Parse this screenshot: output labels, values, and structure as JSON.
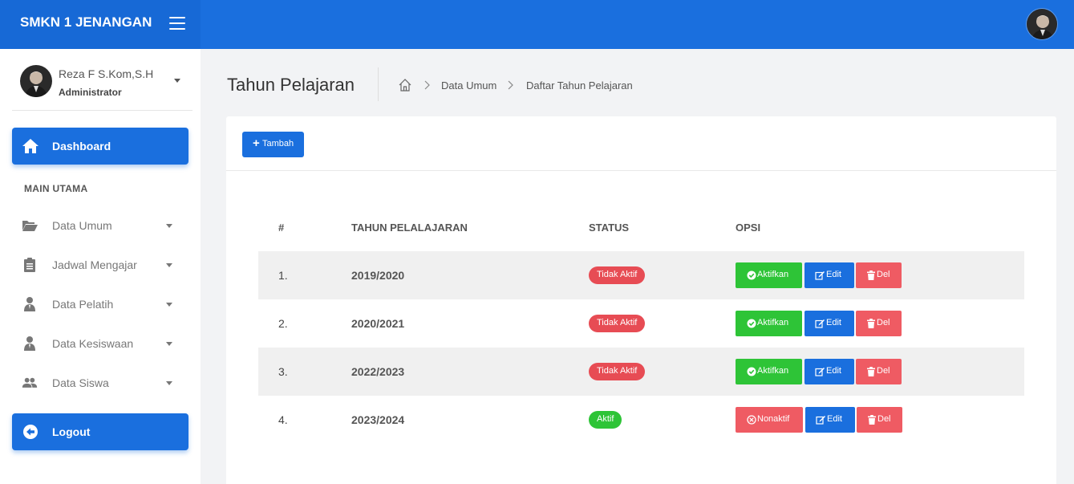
{
  "app": {
    "brand": "SMKN 1 JENANGAN"
  },
  "user": {
    "name": "Reza F S.Kom,S.H",
    "role": "Administrator"
  },
  "sidebar": {
    "dashboard_label": "Dashboard",
    "section_title": "MAIN UTAMA",
    "items": [
      {
        "label": "Data Umum",
        "icon": "folder-open-icon"
      },
      {
        "label": "Jadwal Mengajar",
        "icon": "clipboard-icon"
      },
      {
        "label": "Data Pelatih",
        "icon": "user-icon"
      },
      {
        "label": "Data Kesiswaan",
        "icon": "user-icon"
      },
      {
        "label": "Data Siswa",
        "icon": "users-icon"
      }
    ],
    "logout_label": "Logout"
  },
  "page": {
    "title": "Tahun Pelajaran",
    "breadcrumb": [
      "Data Umum",
      "Daftar Tahun Pelajaran"
    ]
  },
  "toolbar": {
    "add_label": "Tambah"
  },
  "table": {
    "headers": [
      "#",
      "TAHUN PELALAJARAN",
      "STATUS",
      "OPSI"
    ],
    "rows": [
      {
        "no": "1.",
        "year": "2019/2020",
        "status": "Tidak Aktif",
        "toggle": "Aktifkan",
        "edit": "Edit",
        "del": "Del"
      },
      {
        "no": "2.",
        "year": "2020/2021",
        "status": "Tidak Aktif",
        "toggle": "Aktifkan",
        "edit": "Edit",
        "del": "Del"
      },
      {
        "no": "3.",
        "year": "2022/2023",
        "status": "Tidak Aktif",
        "toggle": "Aktifkan",
        "edit": "Edit",
        "del": "Del"
      },
      {
        "no": "4.",
        "year": "2023/2024",
        "status": "Aktif",
        "toggle": "Nonaktif",
        "edit": "Edit",
        "del": "Del"
      }
    ]
  },
  "colors": {
    "primary": "#1a6fde",
    "success": "#2ec437",
    "danger": "#ef5b63",
    "badge_danger": "#e74c54"
  }
}
